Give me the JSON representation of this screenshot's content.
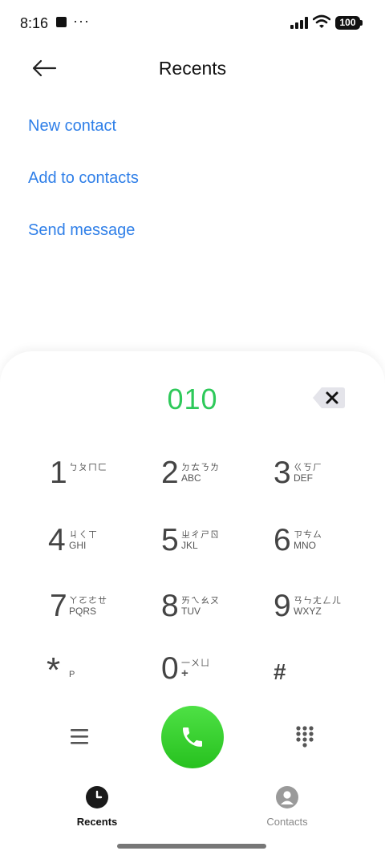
{
  "status_bar": {
    "time": "8:16",
    "dots": "···",
    "battery": "100"
  },
  "header": {
    "title": "Recents"
  },
  "actions": {
    "new_contact": "New contact",
    "add_to_contacts": "Add to contacts",
    "send_message": "Send message"
  },
  "dialer": {
    "number": "010",
    "keys": [
      {
        "num": "1",
        "zh": "ㄅㄆㄇㄈ",
        "lat": ""
      },
      {
        "num": "2",
        "zh": "ㄉㄊㄋㄌ",
        "lat": "ABC"
      },
      {
        "num": "3",
        "zh": "ㄍㄎㄏ",
        "lat": "DEF"
      },
      {
        "num": "4",
        "zh": "ㄐㄑㄒ",
        "lat": "GHI"
      },
      {
        "num": "5",
        "zh": "ㄓㄔㄕㄖ",
        "lat": "JKL"
      },
      {
        "num": "6",
        "zh": "ㄗㄘㄙ",
        "lat": "MNO"
      },
      {
        "num": "7",
        "zh": "ㄚㄛㄜㄝ",
        "lat": "PQRS"
      },
      {
        "num": "8",
        "zh": "ㄞㄟㄠㄡ",
        "lat": "TUV"
      },
      {
        "num": "9",
        "zh": "ㄢㄣㄤㄥㄦ",
        "lat": "WXYZ"
      },
      {
        "num": "*",
        "zh": "",
        "lat": "P"
      },
      {
        "num": "0",
        "zh": "一ㄨㄩ",
        "lat": "+"
      },
      {
        "num": "#",
        "zh": "",
        "lat": ""
      }
    ]
  },
  "bottom_nav": {
    "recents": "Recents",
    "contacts": "Contacts"
  },
  "colors": {
    "link": "#2f7fe8",
    "digits": "#2ec95a",
    "call": "#34c62b"
  }
}
